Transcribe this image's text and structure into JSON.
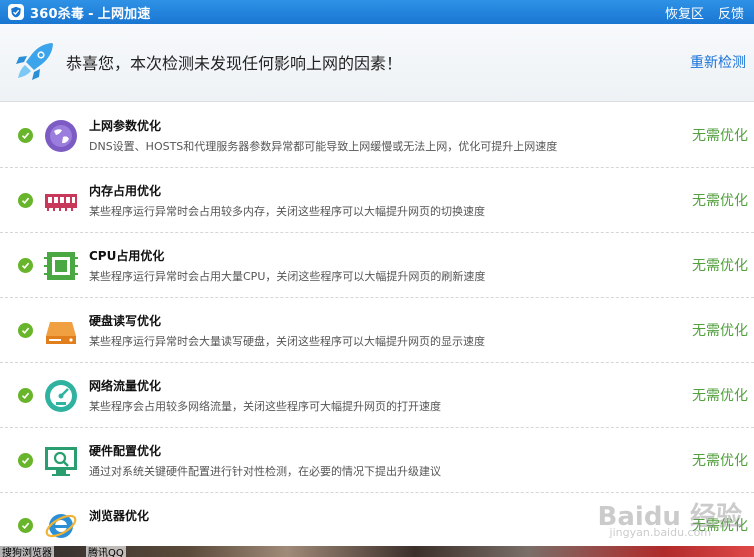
{
  "app": {
    "title_brand": "360杀毒",
    "title_separator": "-",
    "title_module": "上网加速",
    "actions": {
      "restore": "恢复区",
      "feedback": "反馈"
    }
  },
  "result": {
    "message": "恭喜您，本次检测未发现任何影响上网的因素！",
    "recheck": "重新检测"
  },
  "items": [
    {
      "name": "上网参数优化",
      "desc": "DNS设置、HOSTS和代理服务器参数异常都可能导致上网缓慢或无法上网，优化可提升上网速度",
      "status": "无需优化",
      "icon": "globe-icon"
    },
    {
      "name": "内存占用优化",
      "desc": "某些程序运行异常时会占用较多内存，关闭这些程序可以大幅提升网页的切换速度",
      "status": "无需优化",
      "icon": "memory-icon"
    },
    {
      "name": "CPU占用优化",
      "desc": "某些程序运行异常时会占用大量CPU，关闭这些程序可以大幅提升网页的刷新速度",
      "status": "无需优化",
      "icon": "cpu-icon"
    },
    {
      "name": "硬盘读写优化",
      "desc": "某些程序运行异常时会大量读写硬盘，关闭这些程序可以大幅提升网页的显示速度",
      "status": "无需优化",
      "icon": "harddisk-icon"
    },
    {
      "name": "网络流量优化",
      "desc": "某些程序会占用较多网络流量，关闭这些程序可大幅提升网页的打开速度",
      "status": "无需优化",
      "icon": "speedometer-icon"
    },
    {
      "name": "硬件配置优化",
      "desc": "通过对系统关键硬件配置进行针对性检测，在必要的情况下提出升级建议",
      "status": "无需优化",
      "icon": "hardware-check-icon"
    },
    {
      "name": "浏览器优化",
      "desc": "",
      "status": "无需优化",
      "icon": "ie-browser-icon"
    }
  ],
  "colors": {
    "titlebar": "#1976d2",
    "status_green": "#53a03f",
    "link_blue": "#1a73d9",
    "check_green": "#68b42a"
  },
  "bottom_strip": {
    "left_text": "搜狗浏览器",
    "middle_text": "腾讯QQ"
  },
  "watermark": {
    "brand": "Baidu 经验",
    "url": "jingyan.baidu.com"
  }
}
